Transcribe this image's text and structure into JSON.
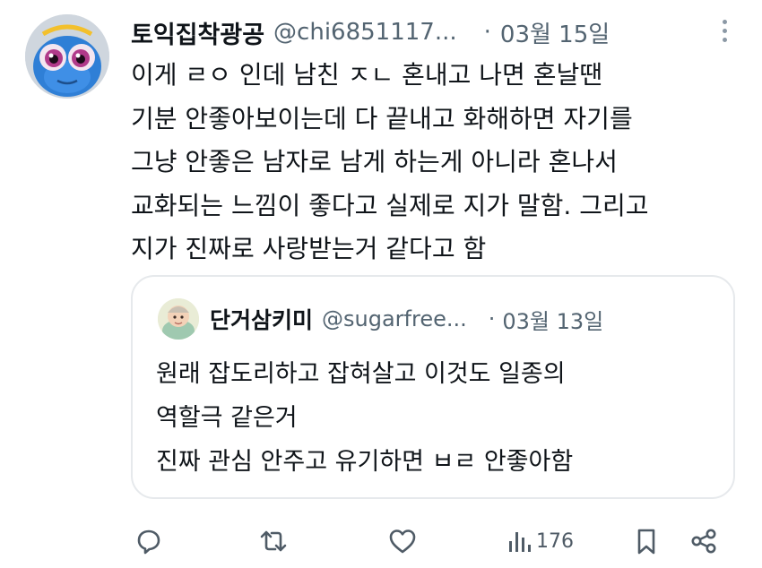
{
  "tweet": {
    "display_name": "토익집착광공",
    "handle": "@chi6851117...",
    "separator": "·",
    "time": "03월 15일",
    "avatar_icon": "blue-fish-cartoon-avatar",
    "body_lines": [
      "이게 ㄹㅇ 인데 남친 ㅈㄴ 혼내고 나면 혼날땐",
      "기분 안좋아보이는데 다 끝내고 화해하면 자기를",
      "그냥 안좋은 남자로 남게 하는게 아니라 혼나서",
      "교화되는 느낌이 좋다고 실제로 지가 말함. 그리고",
      "지가 진짜로 사랑받는거 같다고 함"
    ]
  },
  "quoted_tweet": {
    "display_name": "단거삼키미",
    "handle": "@sugarfree...",
    "separator": "·",
    "time": "03월 13일",
    "avatar_icon": "cartoon-character-avatar",
    "body_lines": [
      "원래 잡도리하고 잡혀살고 이것도 일종의",
      "역할극 같은거",
      "진짜 관심 안주고 유기하면 ㅂㄹ 안좋아함"
    ]
  },
  "actions": {
    "reply_icon": "reply-icon",
    "retweet_icon": "retweet-icon",
    "like_icon": "heart-icon",
    "views_icon": "views-chart-icon",
    "views_count": "176",
    "bookmark_icon": "bookmark-icon",
    "share_icon": "share-icon"
  },
  "colors": {
    "text": "#0f1419",
    "secondary": "#536471",
    "border": "#e6e9ec",
    "icon": "#4f5b66"
  }
}
